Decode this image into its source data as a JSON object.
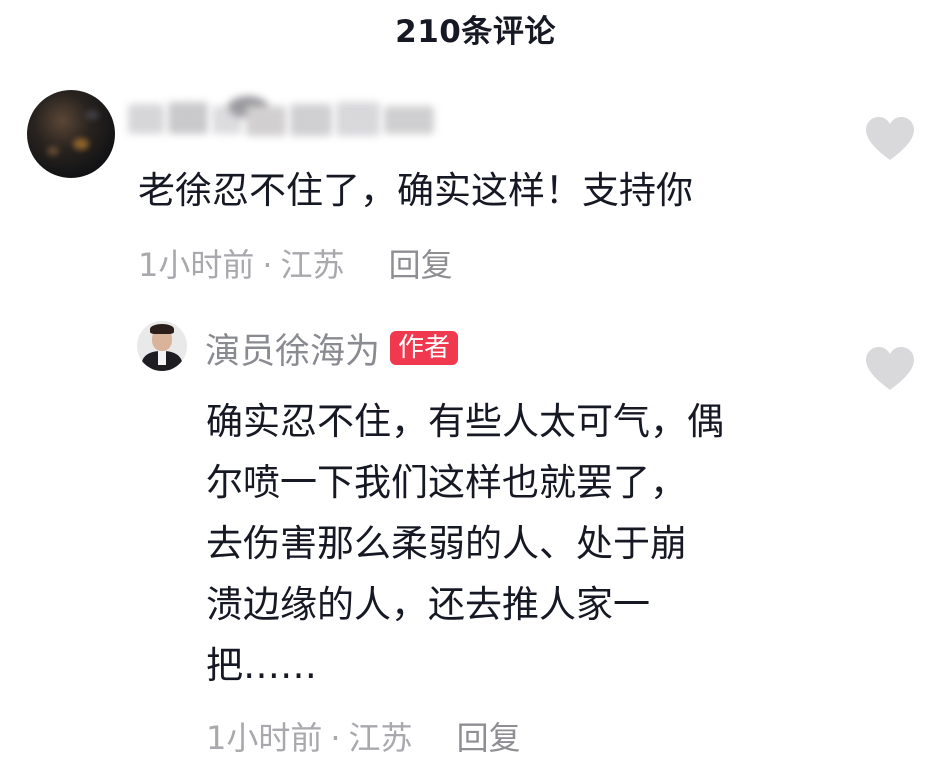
{
  "header": {
    "title": "210条评论"
  },
  "comment": {
    "text": "老徐忍不住了，确实这样！支持你",
    "time": "1小时前",
    "separator": "·",
    "location": "江苏",
    "reply_label": "回复",
    "like_icon": "heart-icon"
  },
  "reply": {
    "author": "演员徐海为",
    "author_badge": "作者",
    "text_lines": [
      "确实忍不住，有些人太可气，偶",
      "尔喷一下我们这样也就罢了，",
      "去伤害那么柔弱的人、处于崩",
      "溃边缘的人，还去推人家一",
      "把……"
    ],
    "time": "1小时前",
    "separator": "·",
    "location": "江苏",
    "reply_label": "回复",
    "like_icon": "heart-icon"
  },
  "colors": {
    "text_primary": "#161823",
    "text_secondary": "#a3a3a8",
    "author_name": "#8a8b91",
    "badge_bg": "#f0384e",
    "heart": "#d9d9dc"
  }
}
